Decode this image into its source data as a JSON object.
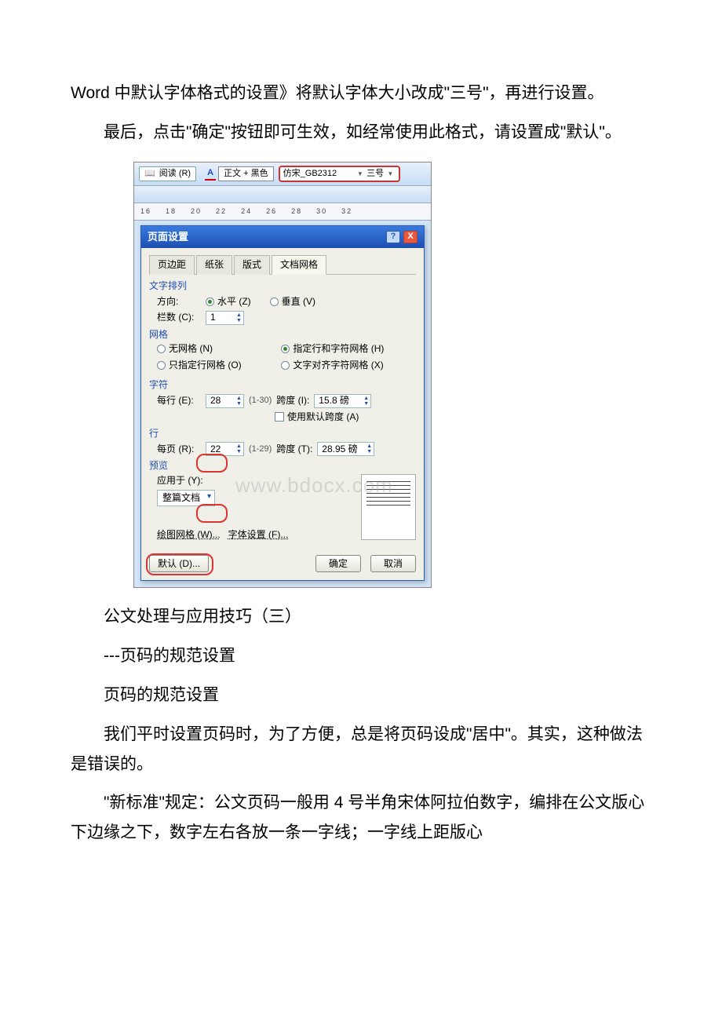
{
  "text": {
    "p1": "Word 中默认字体格式的设置》将默认字体大小改成\"三号\"，再进行设置。",
    "p2": "最后，点击\"确定\"按钮即可生效，如经常使用此格式，请设置成\"默认\"。",
    "p3": "公文处理与应用技巧（三）",
    "p4": "---页码的规范设置",
    "p5": "页码的规范设置",
    "p6": "我们平时设置页码时，为了方便，总是将页码设成\"居中\"。其实，这种做法是错误的。",
    "p7": "\"新标准\"规定：公文页码一般用 4 号半角宋体阿拉伯数字，编排在公文版心下边缘之下，数字左右各放一条一字线；一字线上距版心"
  },
  "toolbar": {
    "read_btn": "阅读 (R)",
    "style_label": "正文 + 黑色",
    "font_name": "仿宋_GB2312",
    "font_size": "三号"
  },
  "ruler": {
    "ticks": [
      "16",
      "18",
      "20",
      "22",
      "24",
      "26",
      "28",
      "30",
      "32"
    ]
  },
  "dialog": {
    "title": "页面设置",
    "tabs": {
      "t1": "页边距",
      "t2": "纸张",
      "t3": "版式",
      "t4": "文档网格"
    },
    "grp_text": "文字排列",
    "dir_label": "方向:",
    "dir_h": "水平 (Z)",
    "dir_v": "垂直 (V)",
    "cols_label": "栏数 (C):",
    "cols_val": "1",
    "grp_grid": "网格",
    "g_none": "无网格 (N)",
    "g_line_char": "指定行和字符网格 (H)",
    "g_line_only": "只指定行网格 (O)",
    "g_align": "文字对齐字符网格 (X)",
    "grp_char": "字符",
    "per_line_label": "每行 (E):",
    "per_line_val": "28",
    "per_line_range": "(1-30)",
    "span_label": "跨度 (I):",
    "span_char_val": "15.8 磅",
    "use_default_span": "使用默认跨度 (A)",
    "grp_line": "行",
    "per_page_label": "每页 (R):",
    "per_page_val": "22",
    "per_page_range": "(1-29)",
    "span2_label": "跨度 (T):",
    "span_line_val": "28.95 磅",
    "grp_preview": "预览",
    "apply_label": "应用于 (Y):",
    "apply_val": "整篇文档",
    "draw_grid": "绘图网格 (W)...",
    "font_set": "字体设置 (F)...",
    "default_btn": "默认 (D)...",
    "ok": "确定",
    "cancel": "取消"
  },
  "watermark": "www.bdocx.com"
}
